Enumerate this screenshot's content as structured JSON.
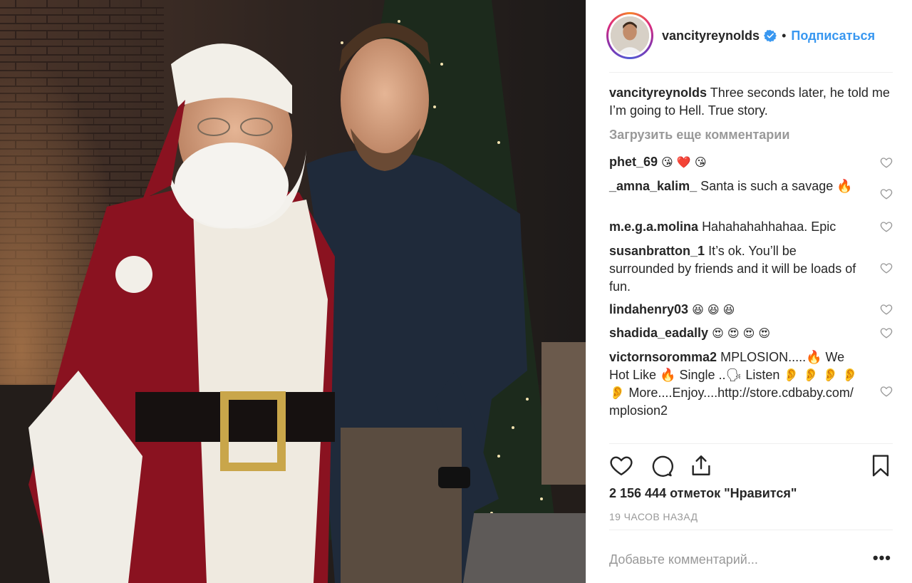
{
  "post": {
    "username": "vancityreynolds",
    "follow_label": "Подписаться",
    "separator": "•",
    "caption_user": "vancityreynolds",
    "caption_text": "Three seconds later, he told me I’m going to Hell. True story.",
    "load_more": "Загрузить еще комментарии",
    "likes": "2 156 444 отметок \"Нравится\"",
    "time_ago": "19 ЧАСОВ НАЗАД",
    "comment_placeholder": "Добавьте комментарий...",
    "more_options": "•••"
  },
  "comments": [
    {
      "user": "phet_69",
      "text": "😘 ❤️ 😘"
    },
    {
      "user": "_amna_kalim_",
      "text": "Santa is such a savage 🔥"
    },
    {
      "user": "m.e.g.a.molina",
      "text": "Hahahahahhahaa. Epic"
    },
    {
      "user": "susanbratton_1",
      "text": "It’s ok. You’ll be surrounded by friends and it will be loads of fun."
    },
    {
      "user": "lindahenry03",
      "text": "😆 😆 😆"
    },
    {
      "user": "shadida_eadally",
      "text": "😍 😍 😍 😍"
    },
    {
      "user": "victornsoromma2",
      "text": "MPLOSION.....🔥 We Hot Like 🔥  Single ..🗣 Listen 👂 👂 👂 👂 👂 More....Enjoy....http://store.cdbaby.com/ mplosion2"
    }
  ],
  "icons": {
    "verified": "verified-badge-icon",
    "like": "heart-icon",
    "comment": "comment-bubble-icon",
    "share": "share-icon",
    "save": "bookmark-icon"
  },
  "colors": {
    "link_blue": "#3897f0",
    "muted_gray": "#999999",
    "text": "#262626",
    "divider": "#efefef"
  }
}
